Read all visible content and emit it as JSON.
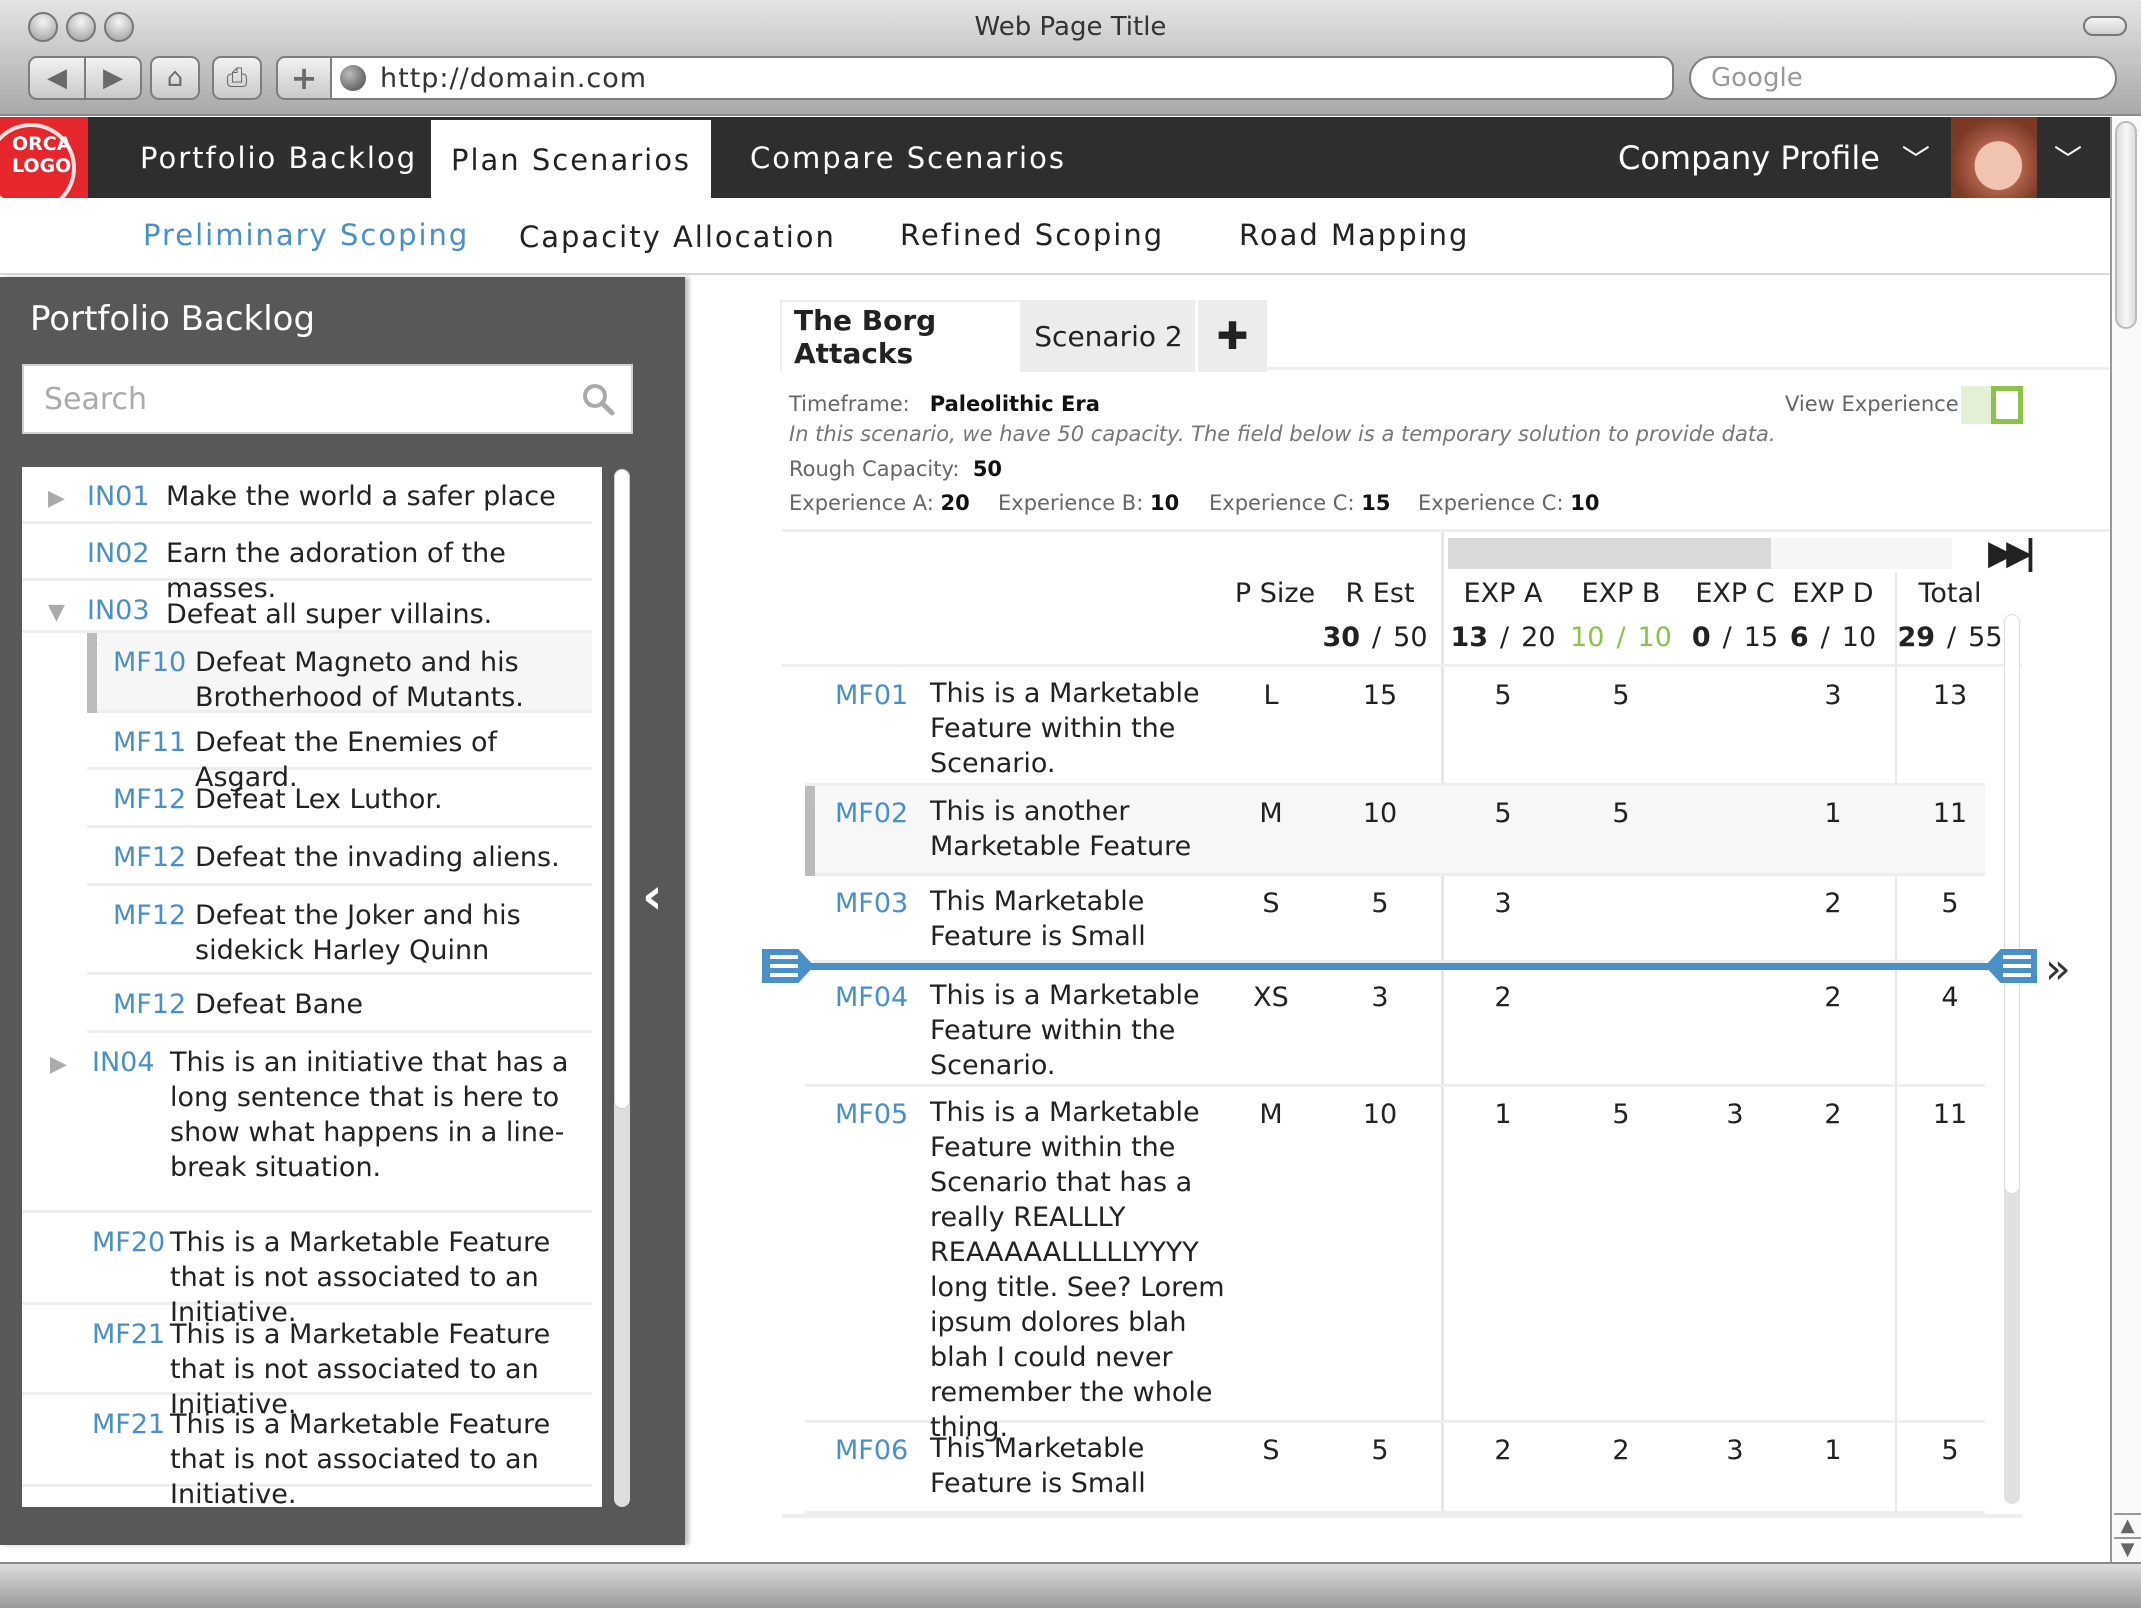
{
  "browser": {
    "window_title": "Web Page Title",
    "url": "http://domain.com",
    "search_placeholder": "Google"
  },
  "app": {
    "logo_text": [
      "ORCA",
      "LOGO"
    ],
    "brand_color": "#e5262c",
    "accent_color": "#4a90c8",
    "nav": [
      {
        "label": "Portfolio Backlog",
        "active": false
      },
      {
        "label": "Plan Scenarios",
        "active": true
      },
      {
        "label": "Compare Scenarios",
        "active": false
      }
    ],
    "company_profile": "Company Profile",
    "subnav": [
      {
        "label": "Preliminary Scoping",
        "active": true
      },
      {
        "label": "Capacity Allocation",
        "active": false
      },
      {
        "label": "Refined Scoping",
        "active": false
      },
      {
        "label": "Road Mapping",
        "active": false
      }
    ]
  },
  "sidebar": {
    "title": "Portfolio Backlog",
    "search_placeholder": "Search",
    "items": [
      {
        "id": "IN01",
        "text": "Make the world a safer place",
        "type": "initiative",
        "expander": "collapsed"
      },
      {
        "id": "IN02",
        "text": "Earn the adoration of the masses.",
        "type": "initiative",
        "expander": "none"
      },
      {
        "id": "IN03",
        "text": "Defeat all super villains.",
        "type": "initiative",
        "expander": "expanded"
      },
      {
        "id": "MF10",
        "text": "Defeat Magneto and his Brotherhood of Mutants.",
        "type": "feature",
        "selected": true
      },
      {
        "id": "MF11",
        "text": "Defeat the Enemies of Asgard.",
        "type": "feature"
      },
      {
        "id": "MF12",
        "text": "Defeat Lex Luthor.",
        "type": "feature"
      },
      {
        "id": "MF12",
        "text": "Defeat the invading aliens.",
        "type": "feature"
      },
      {
        "id": "MF12",
        "text": "Defeat the Joker and his sidekick Harley Quinn",
        "type": "feature"
      },
      {
        "id": "MF12",
        "text": "Defeat Bane",
        "type": "feature"
      },
      {
        "id": "IN04",
        "text": "This is an initiative that has a long sentence that is here to show what happens in a line-break situation.",
        "type": "initiative",
        "expander": "collapsed"
      },
      {
        "id": "MF20",
        "text": "This is a Marketable Feature that is not associated to an Initiative.",
        "type": "orphan"
      },
      {
        "id": "MF21",
        "text": "This is a Marketable Feature that is not associated to an Initiative.",
        "type": "orphan"
      },
      {
        "id": "MF21",
        "text": "This is a Marketable Feature that is not associated to an Initiative.",
        "type": "orphan"
      }
    ]
  },
  "scenario": {
    "tabs": [
      {
        "label": "The Borg Attacks",
        "active": true
      },
      {
        "label": "Scenario 2",
        "active": false
      }
    ],
    "add_tab_icon": "plus-icon",
    "timeframe_label": "Timeframe:",
    "timeframe_value": "Paleolithic Era",
    "note": "In this scenario, we have 50 capacity. The field below is a temporary solution to provide data.",
    "rough_capacity_label": "Rough Capacity:",
    "rough_capacity_value": "50",
    "experiences": [
      {
        "label": "Experience A:",
        "value": "20"
      },
      {
        "label": "Experience B:",
        "value": "10"
      },
      {
        "label": "Experience C:",
        "value": "15"
      },
      {
        "label": "Experience C:",
        "value": "10"
      }
    ],
    "view_experience_label": "View Experience",
    "view_experience_on": true,
    "column_scroll_position": 0.64
  },
  "table": {
    "headers": [
      "P Size",
      "R Est",
      "EXP A",
      "EXP B",
      "EXP C",
      "EXP D",
      "Total"
    ],
    "totals": [
      {
        "used": "30",
        "cap": "50",
        "status": "normal"
      },
      {
        "used": "13",
        "cap": "20",
        "status": "normal"
      },
      {
        "used": "10",
        "cap": "10",
        "status": "full"
      },
      {
        "used": "0",
        "cap": "15",
        "status": "normal"
      },
      {
        "used": "6",
        "cap": "10",
        "status": "normal"
      },
      {
        "used": "29",
        "cap": "55",
        "status": "normal"
      }
    ],
    "sep": "/",
    "rows": [
      {
        "id": "MF01",
        "title": "This is a Marketable Feature within the Scenario.",
        "psize": "L",
        "rest": "15",
        "a": "5",
        "b": "5",
        "c": "",
        "d": "3",
        "total": "13"
      },
      {
        "id": "MF02",
        "title": "This is another Marketable Feature",
        "psize": "M",
        "rest": "10",
        "a": "5",
        "b": "5",
        "c": "",
        "d": "1",
        "total": "11",
        "selected": true
      },
      {
        "id": "MF03",
        "title": "This Marketable Feature is Small",
        "psize": "S",
        "rest": "5",
        "a": "3",
        "b": "",
        "c": "",
        "d": "2",
        "total": "5"
      },
      {
        "id": "MF04",
        "title": "This is a Marketable Feature within the Scenario.",
        "psize": "XS",
        "rest": "3",
        "a": "2",
        "b": "",
        "c": "",
        "d": "2",
        "total": "4"
      },
      {
        "id": "MF05",
        "title": "This is a Marketable Feature within the Scenario that has a really REALLLY REAAAAALLLLLYYYY long title. See? Lorem ipsum dolores blah blah I could never remember the whole thing.",
        "psize": "M",
        "rest": "10",
        "a": "1",
        "b": "5",
        "c": "3",
        "d": "2",
        "total": "11"
      },
      {
        "id": "MF06",
        "title": "This Marketable Feature is Small",
        "psize": "S",
        "rest": "5",
        "a": "2",
        "b": "2",
        "c": "3",
        "d": "1",
        "total": "5"
      }
    ]
  }
}
